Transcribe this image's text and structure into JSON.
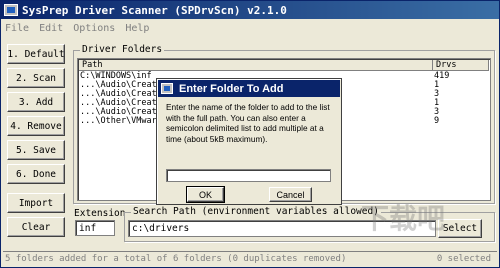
{
  "window": {
    "title": "SysPrep Driver Scanner (SPDrvScn) v2.1.0"
  },
  "menu": [
    "File",
    "Edit",
    "Options",
    "Help"
  ],
  "actions": [
    {
      "id": "default",
      "label": "1. Default"
    },
    {
      "id": "scan",
      "label": "2. Scan"
    },
    {
      "id": "add",
      "label": "3. Add"
    },
    {
      "id": "remove",
      "label": "4. Remove"
    },
    {
      "id": "save",
      "label": "5. Save"
    },
    {
      "id": "done",
      "label": "6. Done"
    }
  ],
  "import_label": "Import",
  "clear_label": "Clear",
  "driver_folders": {
    "label": "Driver Folders",
    "columns": {
      "path": "Path",
      "drvs": "Drvs"
    },
    "rows": [
      {
        "path": "C:\\WINDOWS\\inf",
        "drvs": "419"
      },
      {
        "path": "...\\Audio\\Creativ",
        "drvs": "1"
      },
      {
        "path": "...\\Audio\\Creativ",
        "drvs": "3"
      },
      {
        "path": "...\\Audio\\Creativ",
        "drvs": "1"
      },
      {
        "path": "...\\Audio\\Creativ",
        "drvs": "3"
      },
      {
        "path": "...\\Other\\VMware",
        "drvs": "9"
      }
    ]
  },
  "extension": {
    "label": "Extension",
    "value": "inf"
  },
  "search_path": {
    "label": "Search Path (environment variables allowed)",
    "value": "c:\\drivers",
    "select_label": "Select"
  },
  "status": {
    "text": "5 folders added for a total of 6 folders (0 duplicates removed)",
    "right": "0 selected"
  },
  "dialog": {
    "title": "Enter Folder To Add",
    "message": "Enter the name of the folder to add to the list with the full path. You can also enter a semicolon delimited list to add multiple at a time (about 5kB maximum).",
    "input_value": "",
    "ok_label": "OK",
    "cancel_label": "Cancel"
  },
  "watermark_text": "下载吧"
}
